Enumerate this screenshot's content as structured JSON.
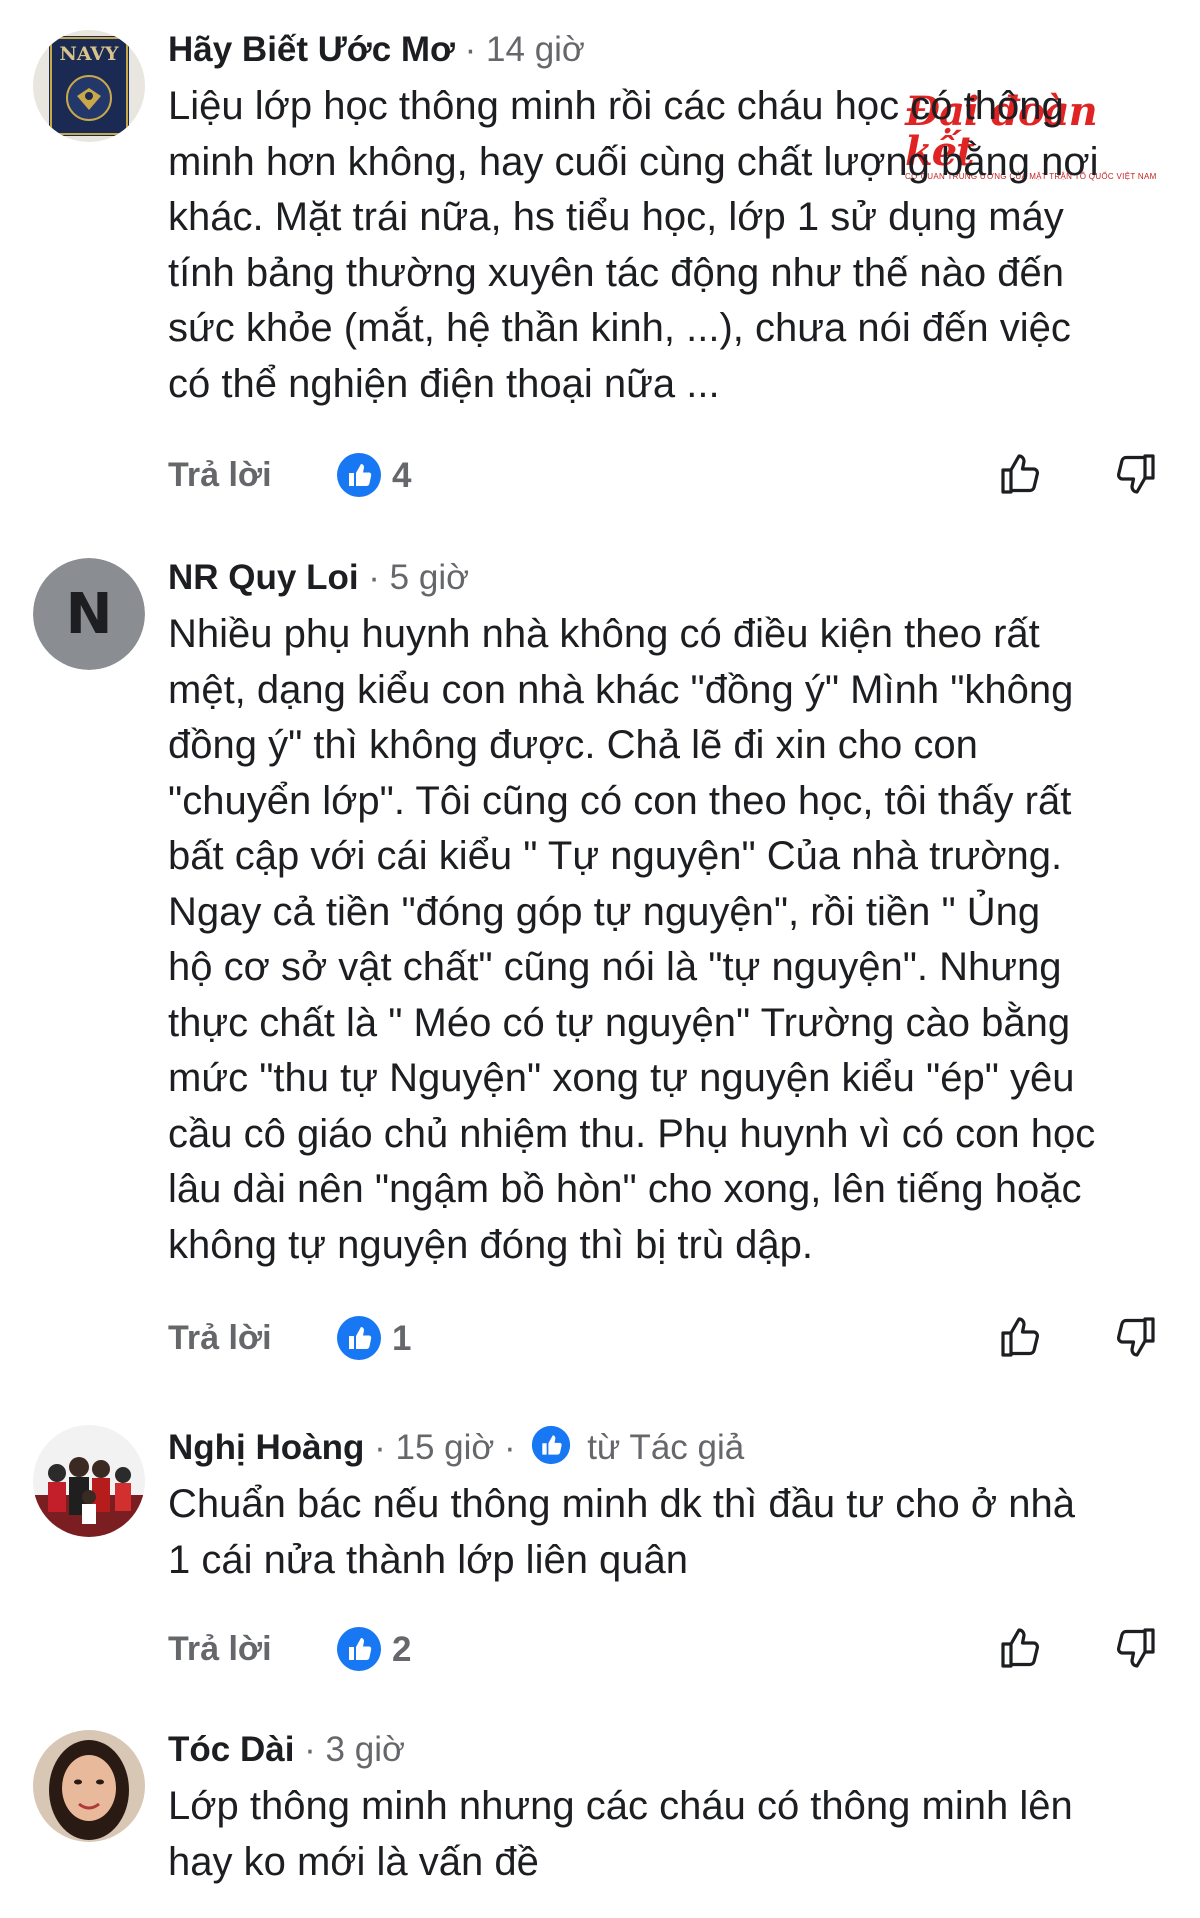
{
  "watermark": {
    "logo": "Đại đoàn kết",
    "tagline": "CƠ QUAN TRUNG ƯƠNG CỦA MẶT TRẬN TỔ QUỐC VIỆT NAM"
  },
  "colors": {
    "like_blue": "#1877f2",
    "text_primary": "#1c1e21",
    "text_secondary": "#65676b",
    "watermark_red": "#e02424"
  },
  "comments": [
    {
      "author": "Hãy Biết Ước Mơ",
      "time": "· 14 giờ",
      "lines": [
        "Liệu lớp học thông minh rồi các cháu học có thông",
        "minh hơn không, hay cuối cùng chất lượng bằng nơi",
        "khác. Mặt trái nữa, hs tiểu học, lớp 1 sử dụng máy",
        "tính bảng thường xuyên tác động như thế nào đến",
        "sức khỏe (mắt, hệ thần kinh, ...), chưa nói đến việc",
        "có thể nghiện điện thoại nữa ..."
      ],
      "reply_label": "Trả lời",
      "like_count": "4",
      "avatar": {
        "text": "NAVY"
      }
    },
    {
      "author": "NR Quy Loi",
      "time": "· 5 giờ",
      "lines": [
        "Nhiều phụ huynh nhà không có điều kiện theo rất",
        "mệt, dạng kiểu con nhà khác \"đồng ý\" Mình \"không",
        "đồng ý\" thì không được. Chả lẽ đi xin cho con",
        "\"chuyển lớp\". Tôi cũng có con theo học, tôi thấy rất",
        "bất cập với cái kiểu \" Tự nguyện\" Của nhà trường.",
        "Ngay cả tiền \"đóng góp tự nguyện\", rồi tiền \" Ủng",
        "hộ cơ sở vật chất\" cũng nói là  \"tự nguyện\". Nhưng",
        "thực chất là \" Méo có tự nguyện\" Trường cào bằng",
        "mức \"thu tự Nguyện\" xong tự nguyện kiểu \"ép\" yêu",
        "cầu cô giáo chủ nhiệm thu. Phụ huynh vì có con học",
        "lâu dài nên \"ngậm bồ hòn\" cho xong, lên tiếng hoặc",
        "không tự nguyện đóng thì bị trù dập."
      ],
      "reply_label": "Trả lời",
      "like_count": "1",
      "avatar": {
        "text": "N"
      }
    },
    {
      "author": "Nghị Hoàng",
      "time": "· 15 giờ ·",
      "badge": "từ Tác giả",
      "lines": [
        "Chuẩn bác nếu thông minh  dk thì đầu tư cho ở nhà",
        "1 cái nửa thành lớp liên quân"
      ],
      "reply_label": "Trả lời",
      "like_count": "2"
    },
    {
      "author": "Tóc Dài",
      "time": "· 3 giờ",
      "lines": [
        "Lớp thông minh nhưng các cháu có thông minh lên",
        "hay ko mới là vấn đề"
      ]
    }
  ]
}
